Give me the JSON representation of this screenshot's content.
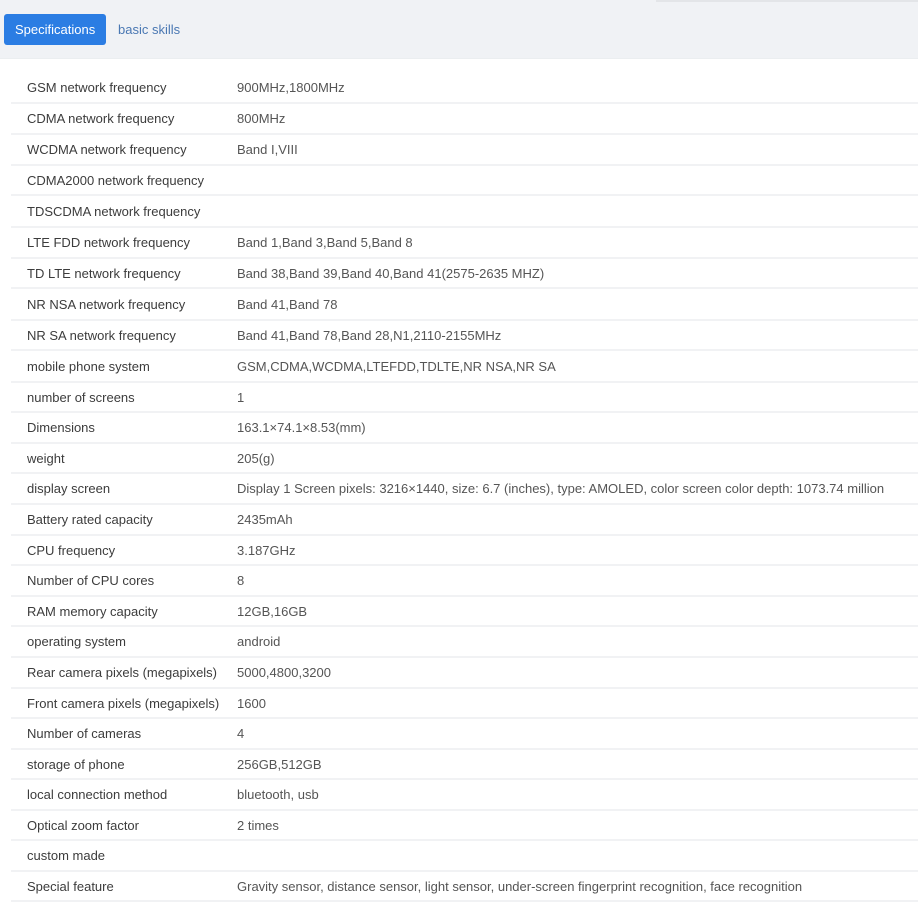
{
  "tabs": [
    {
      "label": "Specifications",
      "active": true
    },
    {
      "label": "basic skills",
      "active": false
    }
  ],
  "colors": {
    "accent": "#2b7de3",
    "link": "#4a78b3",
    "header_bg": "#f0f2f5"
  },
  "specs": [
    {
      "label": "GSM network frequency",
      "value": "900MHz,1800MHz"
    },
    {
      "label": "CDMA network frequency",
      "value": "800MHz"
    },
    {
      "label": "WCDMA network frequency",
      "value": "Band I,VIII"
    },
    {
      "label": "CDMA2000 network frequency",
      "value": ""
    },
    {
      "label": "TDSCDMA network frequency",
      "value": ""
    },
    {
      "label": "LTE FDD network frequency",
      "value": "Band 1,Band 3,Band 5,Band 8"
    },
    {
      "label": "TD LTE network frequency",
      "value": "Band 38,Band 39,Band 40,Band 41(2575-2635 MHZ)"
    },
    {
      "label": "NR NSA network frequency",
      "value": "Band 41,Band 78"
    },
    {
      "label": "NR SA network frequency",
      "value": "Band 41,Band 78,Band 28,N1,2110-2155MHz"
    },
    {
      "label": "mobile phone system",
      "value": "GSM,CDMA,WCDMA,LTEFDD,TDLTE,NR NSA,NR SA"
    },
    {
      "label": "number of screens",
      "value": "1"
    },
    {
      "label": "Dimensions",
      "value": "163.1×74.1×8.53(mm)"
    },
    {
      "label": "weight",
      "value": "205(g)"
    },
    {
      "label": "display screen",
      "value": "Display 1 Screen pixels: 3216×1440, size: 6.7 (inches), type: AMOLED, color screen color depth: 1073.74 million"
    },
    {
      "label": "Battery rated capacity",
      "value": "2435mAh"
    },
    {
      "label": "CPU frequency",
      "value": "3.187GHz"
    },
    {
      "label": "Number of CPU cores",
      "value": "8"
    },
    {
      "label": "RAM memory capacity",
      "value": "12GB,16GB"
    },
    {
      "label": "operating system",
      "value": "android"
    },
    {
      "label": "Rear camera pixels (megapixels)",
      "value": "5000,4800,3200"
    },
    {
      "label": "Front camera pixels (megapixels)",
      "value": "1600"
    },
    {
      "label": "Number of cameras",
      "value": "4"
    },
    {
      "label": "storage of phone",
      "value": "256GB,512GB"
    },
    {
      "label": "local connection method",
      "value": "bluetooth, usb"
    },
    {
      "label": "Optical zoom factor",
      "value": "2 times"
    },
    {
      "label": "custom made",
      "value": ""
    },
    {
      "label": "Special feature",
      "value": "Gravity sensor, distance sensor, light sensor, under-screen fingerprint recognition, face recognition"
    }
  ]
}
